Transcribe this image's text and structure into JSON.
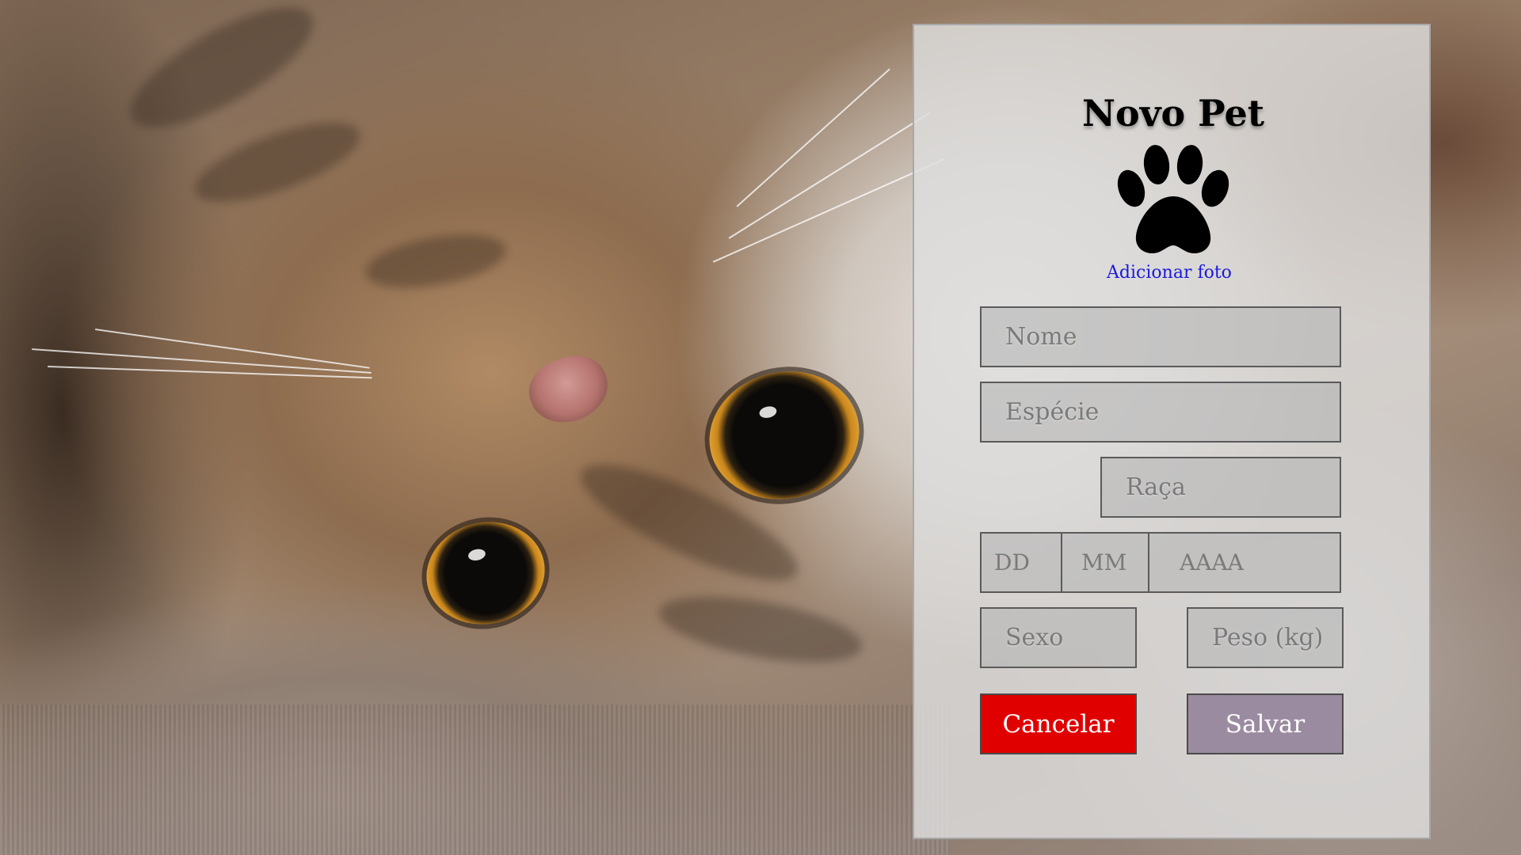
{
  "form": {
    "title": "Novo Pet",
    "add_photo_label": "Adicionar foto",
    "fields": {
      "name_placeholder": "Nome",
      "species_placeholder": "Espécie",
      "breed_placeholder": "Raça",
      "birth_day_placeholder": "DD",
      "birth_month_placeholder": "MM",
      "birth_year_placeholder": "AAAA",
      "sex_placeholder": "Sexo",
      "weight_placeholder": "Peso (kg)"
    },
    "buttons": {
      "cancel_label": "Cancelar",
      "save_label": "Salvar"
    },
    "icons": {
      "photo": "paw-icon"
    }
  },
  "colors": {
    "cancel_button": "#e00000",
    "save_button": "#9b8ba0",
    "link": "#1a1adb",
    "panel": "#dedede"
  }
}
